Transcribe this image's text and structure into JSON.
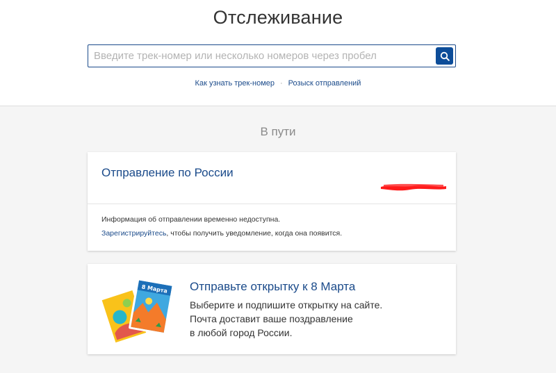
{
  "header": {
    "title": "Отслеживание",
    "search_placeholder": "Введите трек-номер или несколько номеров через пробел",
    "links": [
      "Как узнать трек-номер",
      "Розыск отправлений"
    ],
    "separator": "·"
  },
  "section": {
    "title": "В пути"
  },
  "shipment": {
    "title": "Отправление по России",
    "info_line": "Информация об отправлении временно недоступна.",
    "register_link": "Зарегистрируйтесь",
    "register_suffix": ", чтобы получить уведомление, когда она появится."
  },
  "promo": {
    "title": "Отправьте открытку к 8 Марта",
    "lines": [
      "Выберите и подпишите открытку на сайте.",
      "Почта доставит ваше поздравление",
      "в любой город России."
    ],
    "card_label": "8 Марта"
  },
  "colors": {
    "accent": "#1a4a8a",
    "search_button": "#0d4d99",
    "redaction": "#ff1a1a"
  },
  "icons": {
    "search": "search-icon",
    "postcards": "postcards-illustration"
  }
}
